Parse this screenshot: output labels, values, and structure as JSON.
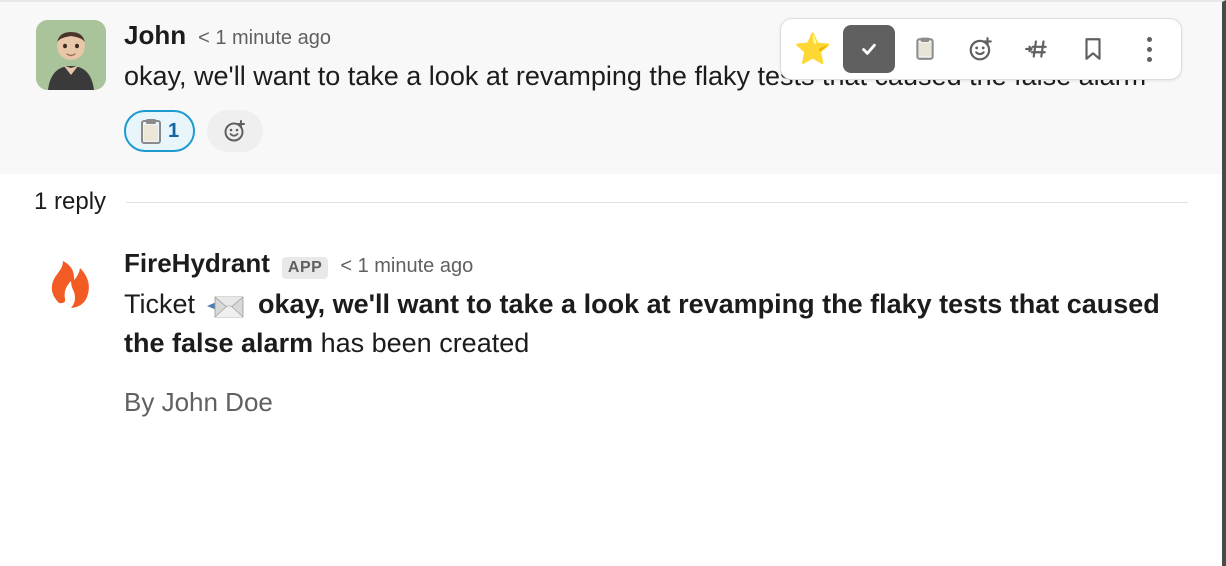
{
  "toolbar": {
    "icons": {
      "star": "star-icon",
      "check": "check-icon",
      "clipboard": "clipboard-icon",
      "emoji": "emoji-add-icon",
      "channel": "forward-to-channel-icon",
      "bookmark": "bookmark-icon",
      "more": "more-actions-icon"
    }
  },
  "message1": {
    "author": "John",
    "timestamp": "< 1 minute ago",
    "text": "okay, we'll want to take a look at revamping the flaky tests that caused the false alarm",
    "reactions": {
      "clipboard_count": "1"
    }
  },
  "thread": {
    "replies_label": "1 reply"
  },
  "message2": {
    "author": "FireHydrant",
    "app_badge": "APP",
    "timestamp": "< 1 minute ago",
    "prefix": "Ticket",
    "bold_text": "okay, we'll want to take a look at revamping the flaky tests that caused the false alarm",
    "suffix": " has been created",
    "byline": "By John Doe"
  }
}
